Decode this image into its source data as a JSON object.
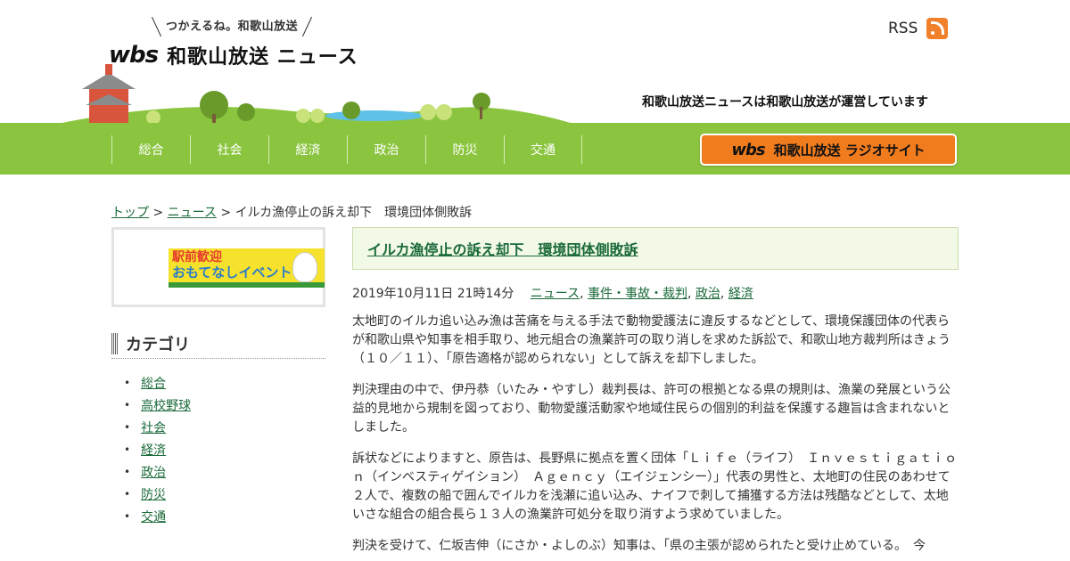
{
  "header": {
    "tagline": "つかえるね。和歌山放送",
    "logo_mark": "wbs",
    "logo_text": "和歌山放送 ニュース",
    "rss_label": "RSS",
    "operator_text": "和歌山放送ニュースは和歌山放送が運営しています"
  },
  "nav": {
    "items": [
      "総合",
      "社会",
      "経済",
      "政治",
      "防災",
      "交通"
    ],
    "radio_mark": "wbs",
    "radio_label": "和歌山放送 ラジオサイト"
  },
  "breadcrumb": {
    "top": "トップ",
    "news": "ニュース",
    "current": "イルカ漁停止の訴え却下　環境団体側敗訴",
    "sep": ">"
  },
  "sidebar": {
    "banner_line1": "駅前歓迎",
    "banner_line2": "おもてなしイベント",
    "category_title": "カテゴリ",
    "categories": [
      "総合",
      "高校野球",
      "社会",
      "経済",
      "政治",
      "防災",
      "交通"
    ]
  },
  "article": {
    "title": "イルカ漁停止の訴え却下　環境団体側敗訴",
    "date": "2019年10月11日 21時14分",
    "tags": [
      "ニュース",
      "事件・事故・裁判",
      "政治",
      "経済"
    ],
    "paragraphs": [
      "太地町のイルカ追い込み漁は苦痛を与える手法で動物愛護法に違反するなどとして、環境保護団体の代表らが和歌山県や知事を相手取り、地元組合の漁業許可の取り消しを求めた訴訟で、和歌山地方裁判所はきょう（１０／１１）、「原告適格が認められない」として訴えを却下しました。",
      "判決理由の中で、伊丹恭（いたみ・やすし）裁判長は、許可の根拠となる県の規則は、漁業の発展という公益的見地から規制を図っており、動物愛護活動家や地域住民らの個別的利益を保護する趣旨は含まれないとしました。",
      "訴状などによりますと、原告は、長野県に拠点を置く団体「Ｌｉｆｅ（ライフ）　Ｉｎｖｅｓｔｉｇａｔｉｏｎ（インベスティゲイション）　Ａｇｅｎｃｙ（エイジェンシー）」代表の男性と、太地町の住民のあわせて２人で、複数の船で囲んでイルカを浅瀬に追い込み、ナイフで刺して捕獲する方法は残酷などとして、太地いさな組合の組合長ら１３人の漁業許可処分を取り消すよう求めていました。",
      "判決を受けて、仁坂吉伸（にさか・よしのぶ）知事は、「県の主張が認められたと受け止めている。　今"
    ]
  }
}
